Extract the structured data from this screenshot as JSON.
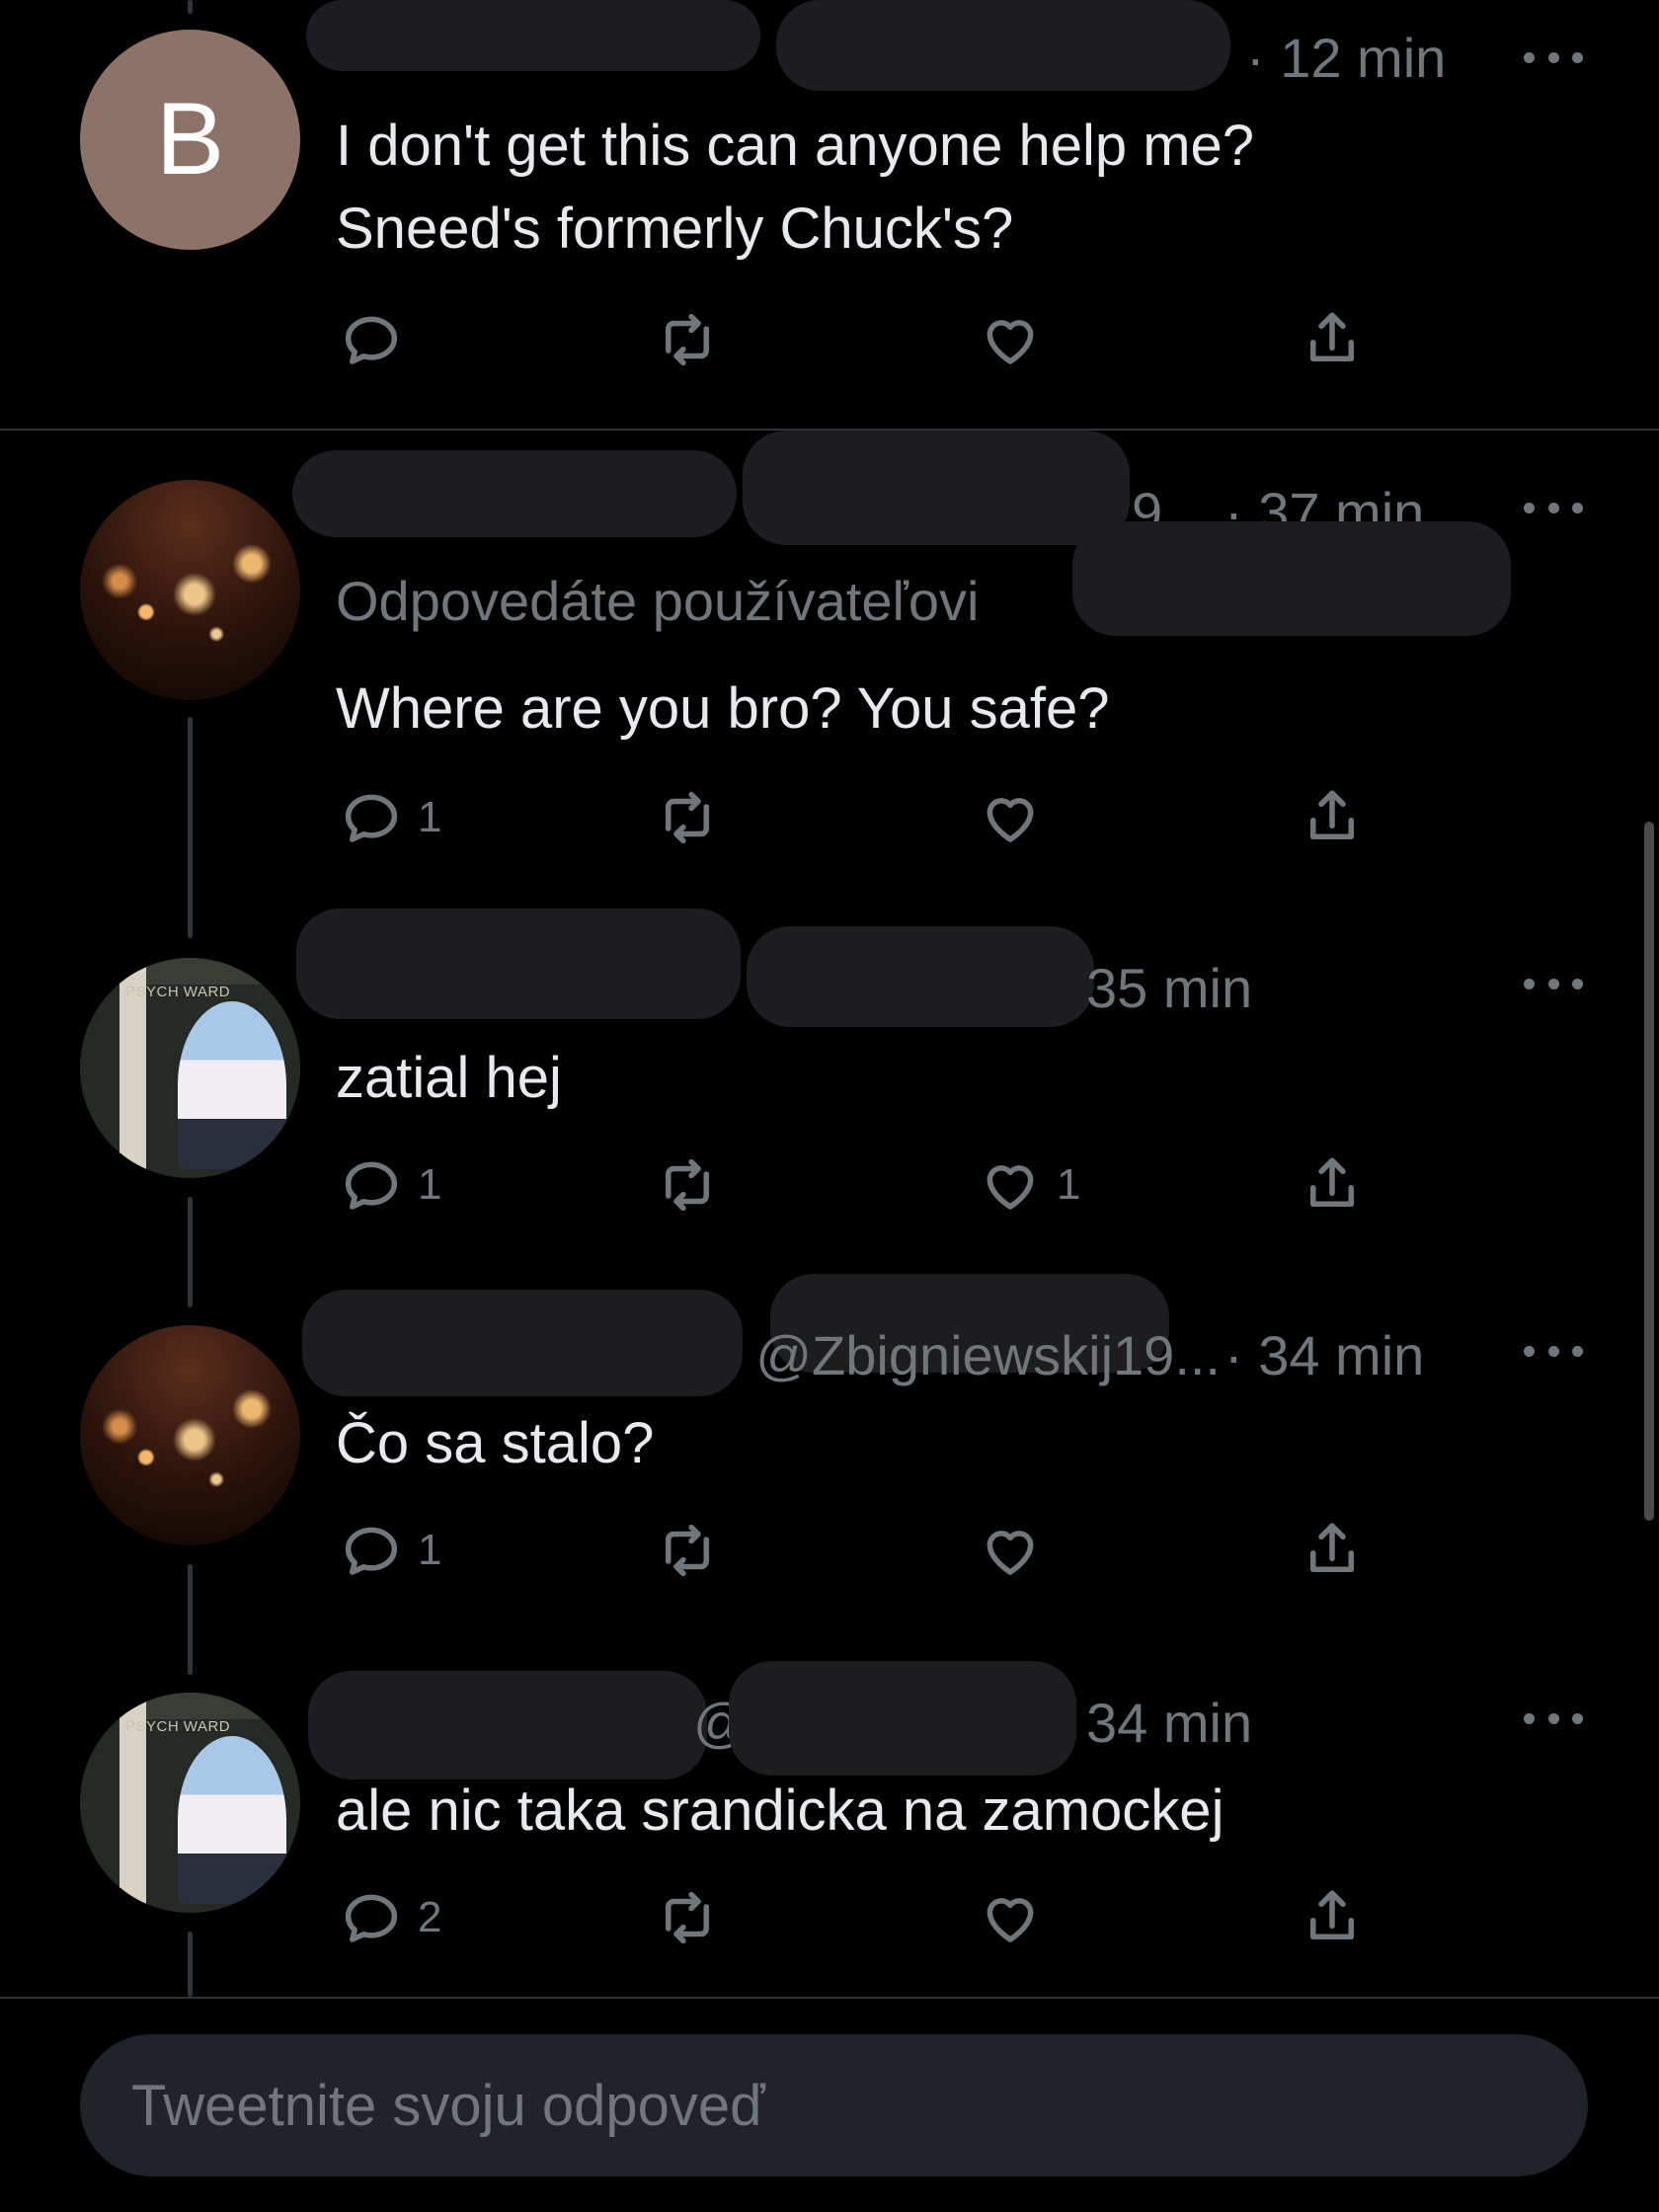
{
  "tweets": [
    {
      "avatar_letter": "B",
      "time": "· 12 min",
      "reply_to": "",
      "text_lines": [
        "I don't get this can anyone help me?",
        "Sneed's formerly Chuck's?"
      ],
      "reply_count": "",
      "like_count": ""
    },
    {
      "handle_fragment": "9...",
      "time": "· 37 min",
      "reply_to": "Odpovedáte používateľovi",
      "text_lines": [
        "Where are you bro? You safe?"
      ],
      "reply_count": "1",
      "like_count": ""
    },
    {
      "handle_fragment": "",
      "time": "35 min",
      "reply_to": "",
      "text_lines": [
        "zatial hej"
      ],
      "reply_count": "1",
      "like_count": "1"
    },
    {
      "handle_fragment": "@Zbigniewskij19...",
      "time": "· 34 min",
      "reply_to": "",
      "text_lines": [
        "Čo sa stalo?"
      ],
      "reply_count": "1",
      "like_count": ""
    },
    {
      "handle_fragment": "@",
      "time": "34 min",
      "reply_to": "",
      "text_lines": [
        "ale nic taka srandicka na zamockej"
      ],
      "reply_count": "2",
      "like_count": ""
    }
  ],
  "icons": {
    "reply": "reply-icon",
    "retweet": "retweet-icon",
    "like": "heart-icon",
    "share": "share-icon",
    "more": "more-icon"
  },
  "avatar_sign": "PSYCH WARD",
  "compose": {
    "placeholder": "Tweetnite svoju odpoveď"
  },
  "colors": {
    "background": "#000000",
    "text": "#e7e9ea",
    "muted": "#71767b",
    "divider": "#2f3336",
    "avatar_b": "#8d7267",
    "compose_bg": "#202327"
  }
}
